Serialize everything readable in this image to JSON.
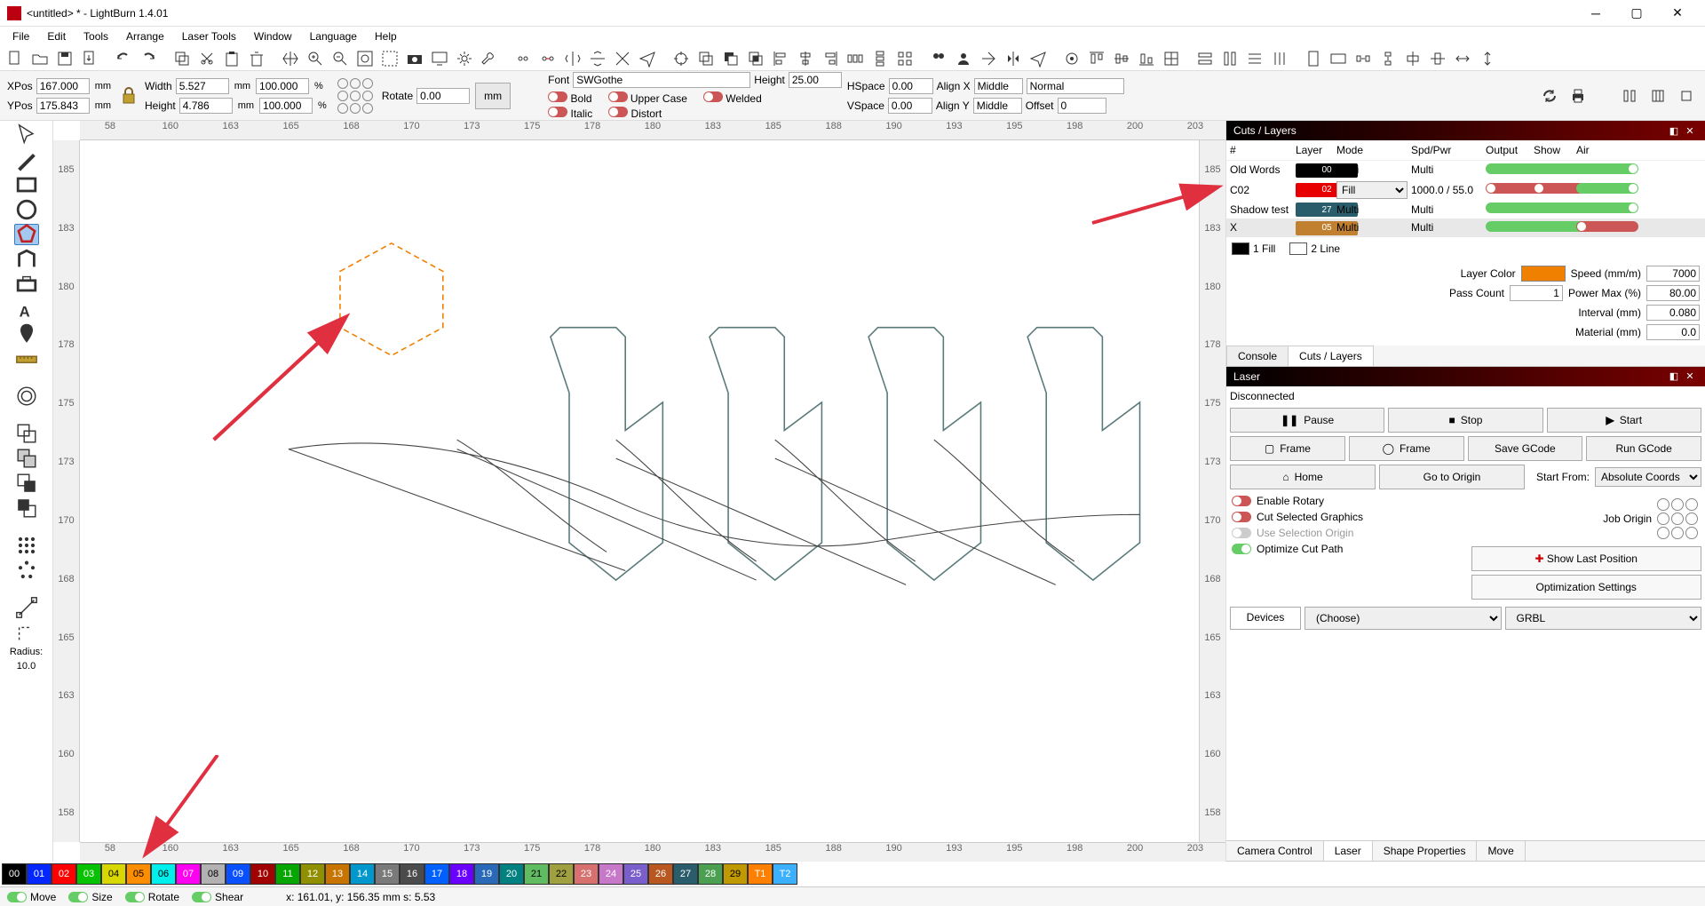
{
  "window": {
    "title": "<untitled> * - LightBurn 1.4.01"
  },
  "menu": [
    "File",
    "Edit",
    "Tools",
    "Arrange",
    "Laser Tools",
    "Window",
    "Language",
    "Help"
  ],
  "position": {
    "xpos_label": "XPos",
    "xpos": "167.000",
    "ypos_label": "YPos",
    "ypos": "175.843",
    "width_label": "Width",
    "width": "5.527",
    "height_label": "Height",
    "height": "4.786",
    "pctw": "100.000",
    "pcth": "100.000",
    "mm": "mm",
    "pct": "%",
    "rotate_label": "Rotate",
    "rotate": "0.00",
    "mm_btn": "mm"
  },
  "font": {
    "label": "Font",
    "value": "SWGothe",
    "heightLabel": "Height",
    "heightVal": "25.00",
    "bold": "Bold",
    "italic": "Italic",
    "upper": "Upper Case",
    "distort": "Distort",
    "welded": "Welded",
    "hspaceLabel": "HSpace",
    "hspace": "0.00",
    "vspaceLabel": "VSpace",
    "vspace": "0.00",
    "alignxLabel": "Align X",
    "alignx": "Middle",
    "alignyLabel": "Align Y",
    "aligny": "Middle",
    "normal": "Normal",
    "offsetLabel": "Offset",
    "offset": "0"
  },
  "ruler_h": [
    "58",
    "160",
    "163",
    "165",
    "168",
    "170",
    "173",
    "175",
    "178",
    "180",
    "183",
    "185",
    "188",
    "190",
    "193",
    "195",
    "198",
    "200",
    "203"
  ],
  "ruler_v": [
    "185",
    "183",
    "180",
    "178",
    "175",
    "173",
    "170",
    "168",
    "165",
    "163",
    "160",
    "158"
  ],
  "radius_label": "Radius:",
  "radius_val": "10.0",
  "cuts": {
    "title": "Cuts / Layers",
    "cols": [
      "#",
      "Layer",
      "Mode",
      "Spd/Pwr",
      "Output",
      "Show",
      "Air"
    ],
    "rows": [
      {
        "name": "Old Words",
        "chip": "00",
        "chipBg": "#000",
        "mode": "Multi",
        "spd": "Multi",
        "out": true,
        "show": true,
        "air": true
      },
      {
        "name": "C02",
        "chip": "02",
        "chipBg": "#e80000",
        "mode": "Fill",
        "modeSel": true,
        "spd": "1000.0 / 55.0",
        "out": false,
        "show": false,
        "air": true
      },
      {
        "name": "Shadow test",
        "chip": "27",
        "chipBg": "#2a5d6b",
        "mode": "Multi",
        "spd": "Multi",
        "out": true,
        "show": true,
        "air": true
      },
      {
        "name": "X",
        "chip": "05",
        "chipBg": "#c08030",
        "mode": "Multi",
        "spd": "Multi",
        "out": true,
        "show": true,
        "air": false,
        "sel": true
      }
    ],
    "fill": "1 Fill",
    "line": "2 Line",
    "layerColorLabel": "Layer Color",
    "layerColor": "#f08000",
    "speedLabel": "Speed (mm/m)",
    "speed": "7000",
    "passLabel": "Pass Count",
    "pass": "1",
    "powerLabel": "Power Max (%)",
    "power": "80.00",
    "intervalLabel": "Interval (mm)",
    "interval": "0.080",
    "materialLabel": "Material (mm)",
    "material": "0.0"
  },
  "cutsTabs": [
    "Console",
    "Cuts / Layers"
  ],
  "laser": {
    "title": "Laser",
    "status": "Disconnected",
    "pause": "Pause",
    "stop": "Stop",
    "start": "Start",
    "frame1": "Frame",
    "frame2": "Frame",
    "saveg": "Save GCode",
    "rung": "Run GCode",
    "home": "Home",
    "goto": "Go to Origin",
    "startFromLabel": "Start From:",
    "startFrom": "Absolute Coords",
    "jobOrigin": "Job Origin",
    "enableRotary": "Enable Rotary",
    "cutSel": "Cut Selected Graphics",
    "useSelOrigin": "Use Selection Origin",
    "optimize": "Optimize Cut Path",
    "showLast": "Show Last Position",
    "optSettings": "Optimization Settings",
    "devices": "Devices",
    "choose": "(Choose)",
    "grbl": "GRBL"
  },
  "bottomTabs": [
    "Camera Control",
    "Laser",
    "Shape Properties",
    "Move"
  ],
  "palette": [
    {
      "t": "00",
      "c": "#000"
    },
    {
      "t": "01",
      "c": "#0228ff"
    },
    {
      "t": "02",
      "c": "#ff0000"
    },
    {
      "t": "03",
      "c": "#06c200"
    },
    {
      "t": "04",
      "c": "#d8d800"
    },
    {
      "t": "05",
      "c": "#ff8d00"
    },
    {
      "t": "06",
      "c": "#00efec"
    },
    {
      "t": "07",
      "c": "#ff00f2"
    },
    {
      "t": "08",
      "c": "#b2b2b2"
    },
    {
      "t": "09",
      "c": "#0a50ff"
    },
    {
      "t": "10",
      "c": "#a00000"
    },
    {
      "t": "11",
      "c": "#06a500"
    },
    {
      "t": "12",
      "c": "#8f8f00"
    },
    {
      "t": "13",
      "c": "#c87400"
    },
    {
      "t": "14",
      "c": "#0097cd"
    },
    {
      "t": "15",
      "c": "#7a7a7a"
    },
    {
      "t": "16",
      "c": "#4b4b4b"
    },
    {
      "t": "17",
      "c": "#0060ff"
    },
    {
      "t": "18",
      "c": "#6a00ff"
    },
    {
      "t": "19",
      "c": "#2a68b8"
    },
    {
      "t": "20",
      "c": "#008080"
    },
    {
      "t": "21",
      "c": "#60bc60"
    },
    {
      "t": "22",
      "c": "#a0a040"
    },
    {
      "t": "23",
      "c": "#d87070"
    },
    {
      "t": "24",
      "c": "#c878c8"
    },
    {
      "t": "25",
      "c": "#7a5ecb"
    },
    {
      "t": "26",
      "c": "#b85820"
    },
    {
      "t": "27",
      "c": "#2a5d6b"
    },
    {
      "t": "28",
      "c": "#4aa050"
    },
    {
      "t": "29",
      "c": "#c09800"
    },
    {
      "t": "T1",
      "c": "#ff8000"
    },
    {
      "t": "T2",
      "c": "#3ab0ff"
    }
  ],
  "status": {
    "move": "Move",
    "size": "Size",
    "rotate": "Rotate",
    "shear": "Shear",
    "coords": "x: 161.01, y: 156.35 mm  s: 5.53"
  }
}
